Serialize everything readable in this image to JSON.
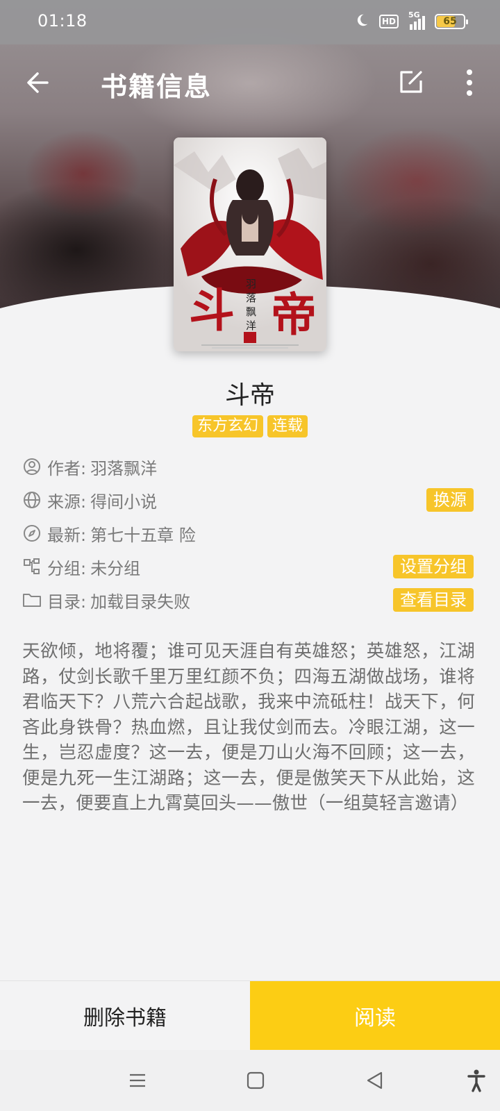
{
  "status_bar": {
    "time": "01:18",
    "hd": "HD",
    "network": "5G",
    "battery": "65",
    "icons": [
      "moon-icon",
      "hd-icon",
      "signal-5g-icon",
      "battery-icon"
    ]
  },
  "toolbar": {
    "title": "书籍信息",
    "icons": [
      "back-arrow-icon",
      "edit-icon",
      "more-vertical-icon"
    ]
  },
  "book": {
    "title": "斗帝",
    "cover": {
      "title_text": "斗帝",
      "author_text": "羽落飘洋",
      "seal_text": "著"
    },
    "tags": [
      "东方玄幻",
      "连载"
    ],
    "info": {
      "author": {
        "label": "作者:",
        "value": "羽落飘洋",
        "icon": "user-circle-icon"
      },
      "source": {
        "label": "来源:",
        "value": "得间小说",
        "icon": "globe-icon",
        "action": "换源"
      },
      "latest": {
        "label": "最新:",
        "value": "第七十五章 险",
        "icon": "compass-icon"
      },
      "group": {
        "label": "分组:",
        "value": "未分组",
        "icon": "group-icon",
        "action": "设置分组"
      },
      "toc": {
        "label": "目录:",
        "value": "加载目录失败",
        "icon": "folder-icon",
        "action": "查看目录"
      }
    },
    "intro": "天欲倾，地将覆；谁可见天涯自有英雄怒；英雄怒，江湖路，仗剑长歌千里万里红颜不负；四海五湖做战场，谁将君临天下？八荒六合起战歌，我来中流砥柱！战天下，何吝此身铁骨？热血燃，且让我仗剑而去。冷眼江湖，这一生，岂忍虚度？这一去，便是刀山火海不回顾；这一去，便是九死一生江湖路；这一去，便是傲笑天下从此始，这一去，便要直上九霄莫回头——傲世（一组莫轻言邀请）"
  },
  "actions": {
    "delete": "删除书籍",
    "read": "阅读"
  },
  "nav": {
    "icons": [
      "menu-icon",
      "home-square-icon",
      "back-triangle-icon",
      "accessibility-icon"
    ]
  },
  "colors": {
    "accent": "#fccd14",
    "tag": "#f7c52a",
    "text_secondary": "#7a7a7a"
  }
}
